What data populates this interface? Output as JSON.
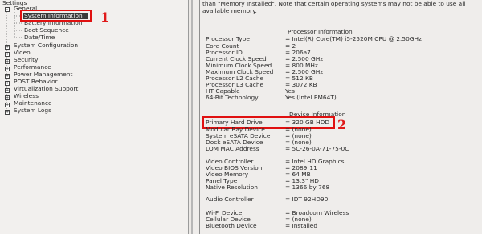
{
  "left": {
    "title": "Settings",
    "tree": [
      {
        "label": "General",
        "level": 0,
        "box": "-"
      },
      {
        "label": "System Information",
        "level": 1,
        "selected": true
      },
      {
        "label": "Battery Information",
        "level": 1
      },
      {
        "label": "Boot Sequence",
        "level": 1
      },
      {
        "label": "Date/Time",
        "level": 1
      },
      {
        "label": "System Configuration",
        "level": 0,
        "box": "+"
      },
      {
        "label": "Video",
        "level": 0,
        "box": "+"
      },
      {
        "label": "Security",
        "level": 0,
        "box": "+"
      },
      {
        "label": "Performance",
        "level": 0,
        "box": "+"
      },
      {
        "label": "Power Management",
        "level": 0,
        "box": "+"
      },
      {
        "label": "POST Behavior",
        "level": 0,
        "box": "+"
      },
      {
        "label": "Virtualization Support",
        "level": 0,
        "box": "+"
      },
      {
        "label": "Wireless",
        "level": 0,
        "box": "+"
      },
      {
        "label": "Maintenance",
        "level": 0,
        "box": "+"
      },
      {
        "label": "System Logs",
        "level": 0,
        "box": "+"
      }
    ]
  },
  "annotations": {
    "one": "1",
    "two": "2"
  },
  "right": {
    "top_note": "than \"Memory Installed\". Note that certain operating systems may not be able to use all available memory.",
    "processor_header": "Processor Information",
    "processor": [
      {
        "label": "Processor Type",
        "value": "= Intel(R) Core(TM) i5-2520M CPU @ 2.50GHz"
      },
      {
        "label": "Core Count",
        "value": "= 2"
      },
      {
        "label": "Processor ID",
        "value": "= 206a7"
      },
      {
        "label": "Current Clock Speed",
        "value": "= 2.500 GHz"
      },
      {
        "label": "Minimum Clock Speed",
        "value": "= 800 MHz"
      },
      {
        "label": "Maximum Clock Speed",
        "value": "= 2.500 GHz"
      },
      {
        "label": "Processor L2 Cache",
        "value": "= 512 KB"
      },
      {
        "label": "Processor L3 Cache",
        "value": "= 3072 KB"
      },
      {
        "label": "HT Capable",
        "value": "Yes"
      },
      {
        "label": "64-Bit Technology",
        "value": "Yes (Intel EM64T)"
      }
    ],
    "device_header": "Device Information",
    "device1": [
      {
        "label": "Primary Hard Drive",
        "value": "= 320 GB HDD"
      },
      {
        "label": "Modular Bay Device",
        "value": "= (none)"
      },
      {
        "label": "System eSATA Device",
        "value": "= (none)"
      },
      {
        "label": "Dock eSATA Device",
        "value": "= (none)"
      },
      {
        "label": "LOM MAC Address",
        "value": "= 5C-26-0A-71-75-0C"
      }
    ],
    "device2": [
      {
        "label": "Video Controller",
        "value": "= Intel HD Graphics"
      },
      {
        "label": "Video BIOS Version",
        "value": "= 2089r11"
      },
      {
        "label": "Video Memory",
        "value": "= 64 MB"
      },
      {
        "label": "Panel Type",
        "value": "= 13.3\" HD"
      },
      {
        "label": "Native Resolution",
        "value": "= 1366 by 768"
      }
    ],
    "device3": [
      {
        "label": "Audio Controller",
        "value": "= IDT 92HD90"
      }
    ],
    "device4": [
      {
        "label": "Wi-Fi Device",
        "value": "= Broadcom Wireless"
      },
      {
        "label": "Cellular Device",
        "value": "= (none)"
      },
      {
        "label": "Bluetooth Device",
        "value": "= Installed"
      }
    ]
  }
}
